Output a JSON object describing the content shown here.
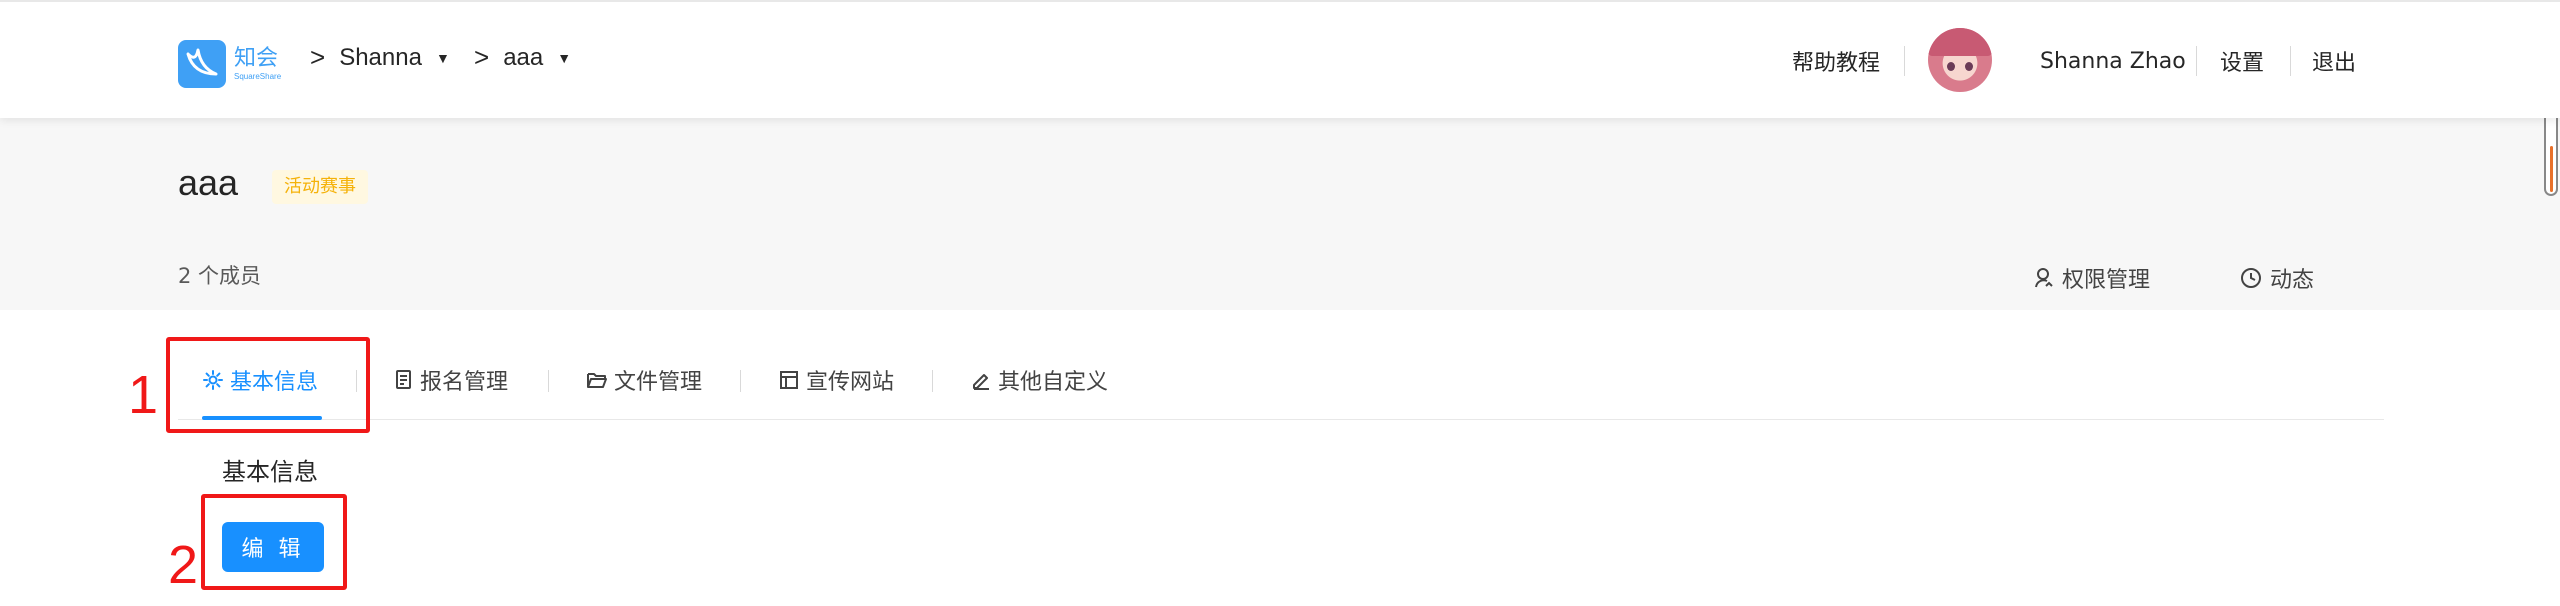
{
  "brand": {
    "name": "知会",
    "subtitle": "SquareShare"
  },
  "breadcrumb": {
    "org": "Shanna",
    "project": "aaa"
  },
  "header_right": {
    "help": "帮助教程",
    "username": "Shanna Zhao",
    "settings": "设置",
    "logout": "退出"
  },
  "project": {
    "title": "aaa",
    "tag": "活动赛事",
    "members": "2 个成员",
    "links": {
      "permissions": "权限管理",
      "activity": "动态"
    }
  },
  "tabs": [
    {
      "label": "基本信息",
      "icon": "gear-icon",
      "active": true
    },
    {
      "label": "报名管理",
      "icon": "document-icon",
      "active": false
    },
    {
      "label": "文件管理",
      "icon": "folder-icon",
      "active": false
    },
    {
      "label": "宣传网站",
      "icon": "layout-icon",
      "active": false
    },
    {
      "label": "其他自定义",
      "icon": "pencil-icon",
      "active": false
    }
  ],
  "main": {
    "section_title": "基本信息",
    "edit_button": "编 辑"
  },
  "annotations": {
    "first": "1",
    "second": "2"
  },
  "colors": {
    "primary": "#1890ff",
    "annotation": "#f01818",
    "tag_text": "#f5b20a",
    "tag_bg": "#fff8e1"
  }
}
